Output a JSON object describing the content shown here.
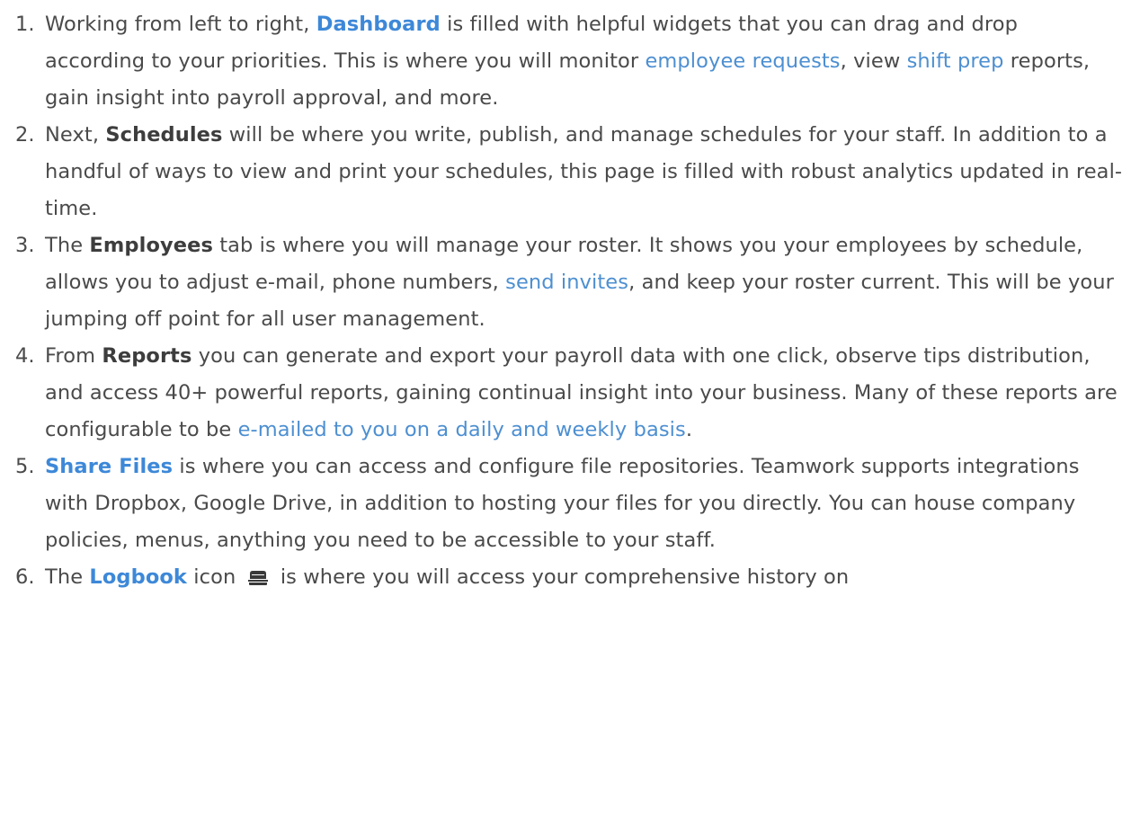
{
  "items": [
    {
      "num": "1.",
      "t0": "Working from left to right, ",
      "k": "Dashboard",
      "t1": " is filled with helpful widgets that you can drag and drop according to your priorities. This is where you will monitor ",
      "l1": "employee requests",
      "t2": ", view ",
      "l2": "shift prep",
      "t3": " reports, gain insight into payroll approval, and more."
    },
    {
      "num": "2.",
      "t0": "Next, ",
      "k": "Schedules",
      "t1": " will be where you write, publish, and manage schedules for your staff. In addition to a handful of ways to view and print your schedules, this page is filled with robust analytics updated in real-time."
    },
    {
      "num": "3.",
      "t0": "The ",
      "k": "Employees",
      "t1": " tab is where you will manage your roster. It shows you your employees by schedule, allows you to adjust e-mail, phone numbers, ",
      "l1": "send invites",
      "t2": ", and keep your roster current. This will be your jumping off point for all user management."
    },
    {
      "num": "4.",
      "t0": "From ",
      "k": "Reports",
      "t1": " you can generate and export your payroll data with one click, observe tips distribution, and access 40+ powerful reports, gaining continual insight into your business. Many of these reports are configurable to be ",
      "l1": "e-mailed to you on a daily and weekly basis",
      "t2": "."
    },
    {
      "num": "5.",
      "k": "Share Files",
      "t1": " is where you can access and configure file repositories. Teamwork supports integrations with Dropbox, Google Drive, in addition to hosting your files for you directly. You can house company policies, menus, anything you need to be accessible to your staff."
    },
    {
      "num": "6.",
      "t0": "The ",
      "k": "Logbook",
      "t1": " icon",
      "icon": "logbook-icon",
      "t2": " is where you will access your comprehensive history on"
    }
  ],
  "colors": {
    "text": "#4a4a4a",
    "link": "#4d8fd1",
    "keyword_link": "#3d88d8"
  }
}
